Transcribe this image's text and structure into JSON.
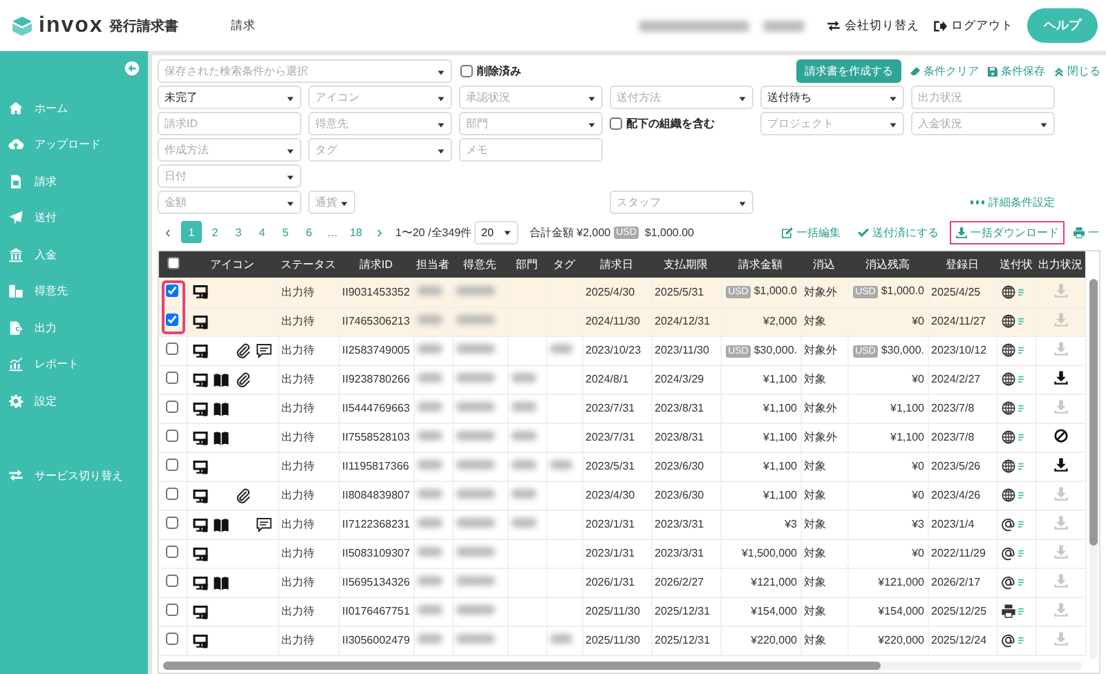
{
  "header": {
    "logo": "invox",
    "product": "発行請求書",
    "nav": "請求",
    "redacted": [
      {
        "kind": "company"
      },
      {
        "kind": "user"
      }
    ],
    "actions": [
      {
        "kind": "switch",
        "label": "会社切り替え"
      },
      {
        "kind": "logout",
        "label": "ログアウト"
      }
    ],
    "help": "ヘルプ"
  },
  "sidebar": {
    "items": [
      {
        "kind": "home",
        "label": "ホーム"
      },
      {
        "kind": "upload",
        "label": "アップロード"
      },
      {
        "kind": "document",
        "label": "請求"
      },
      {
        "kind": "send",
        "label": "送付"
      },
      {
        "kind": "bank",
        "label": "入金"
      },
      {
        "kind": "building",
        "label": "得意先"
      },
      {
        "kind": "export",
        "label": "出力"
      },
      {
        "kind": "chart",
        "label": "レポート"
      },
      {
        "kind": "gear",
        "label": "設定"
      }
    ],
    "footer": {
      "kind": "switch",
      "label": "サービス切り替え"
    }
  },
  "filters": {
    "saved": {
      "placeholder": "保存された検索条件から選択"
    },
    "deleted": {
      "label": "削除済み",
      "checked": false
    },
    "actions": [
      {
        "kind": "primary",
        "label": "請求書を作成する"
      },
      {
        "kind": "eraser",
        "label": "条件クリア"
      },
      {
        "kind": "save",
        "label": "条件保存"
      },
      {
        "kind": "collapse",
        "label": "閉じる"
      }
    ],
    "rows": [
      [
        {
          "kind": "select",
          "value": "未完了"
        },
        {
          "kind": "select",
          "placeholder": "アイコン"
        },
        {
          "kind": "select",
          "placeholder": "承認状況"
        },
        {
          "kind": "select",
          "placeholder": "送付方法"
        },
        {
          "kind": "select",
          "value": "送付待ち"
        },
        {
          "kind": "input",
          "placeholder": "出力状況"
        }
      ],
      [
        {
          "kind": "input",
          "placeholder": "請求ID"
        },
        {
          "kind": "select",
          "placeholder": "得意先"
        },
        {
          "kind": "select",
          "placeholder": "部門"
        },
        {
          "kind": "checkbox",
          "label": "配下の組織を含む",
          "checked": false
        },
        {
          "kind": "select",
          "placeholder": "プロジェクト"
        },
        {
          "kind": "select",
          "placeholder": "入金状況"
        }
      ],
      [
        {
          "kind": "select",
          "placeholder": "作成方法"
        },
        {
          "kind": "select",
          "placeholder": "タグ"
        },
        {
          "kind": "input",
          "placeholder": "メモ"
        }
      ],
      [
        {
          "kind": "select",
          "placeholder": "日付"
        }
      ],
      [
        {
          "kind": "select",
          "placeholder": "金額"
        },
        {
          "kind": "small-select",
          "placeholder": "通貨"
        },
        "",
        {
          "kind": "select",
          "placeholder": "スタッフ"
        }
      ]
    ],
    "advanced": "詳細条件設定"
  },
  "pagination": {
    "prev": "‹",
    "next": "›",
    "pages": [
      {
        "label": "1",
        "selected": true
      },
      {
        "label": "2",
        "selected": false
      },
      {
        "label": "3",
        "selected": false
      },
      {
        "label": "4",
        "selected": false
      },
      {
        "label": "5",
        "selected": false
      },
      {
        "label": "6",
        "selected": false
      },
      {
        "label": "…",
        "selected": false
      },
      {
        "label": "18",
        "selected": false
      }
    ],
    "range": "1〜20 /全349件",
    "per_page": "20",
    "total_label": "合計金額",
    "total_jpy": "¥2,000",
    "total_badge": "USD",
    "total_usd": "$1,000.00"
  },
  "toolbar": [
    {
      "kind": "edit",
      "label": "一括編集",
      "callout": false
    },
    {
      "kind": "sent",
      "label": "送付済にする",
      "callout": false
    },
    {
      "kind": "download",
      "label": "一括ダウンロード",
      "callout": true
    },
    {
      "kind": "print",
      "label": "一",
      "callout": false
    }
  ],
  "table": {
    "header_checked": false,
    "checkbox_callout": true,
    "columns": [
      "アイコン",
      "ステータス",
      "請求ID",
      "担当者",
      "得意先",
      "部門",
      "タグ",
      "請求日",
      "支払期限",
      "請求金額",
      "消込",
      "消込残高",
      "登録日",
      "送付状",
      "出力状況"
    ],
    "rows": [
      {
        "checked": true,
        "icons": [
          {
            "kind": "monitor"
          }
        ],
        "status": "出力待",
        "id": "II9031453352",
        "hidden_cells": [
          {
            "kind": "assignee"
          },
          {
            "kind": "customer"
          }
        ],
        "invoice_date": "2025/4/30",
        "due": "2025/5/31",
        "amount": {
          "badge": "USD",
          "text": "$1,000.0"
        },
        "reconcile": "対象外",
        "balance": {
          "badge": "USD",
          "text": "$1,000.0"
        },
        "registered": "2025/4/25",
        "send": {
          "kind": "web"
        },
        "output": {
          "kind": "pending"
        }
      },
      {
        "checked": true,
        "icons": [
          {
            "kind": "monitor"
          }
        ],
        "status": "出力待",
        "id": "II7465306213",
        "hidden_cells": [
          {
            "kind": "assignee"
          },
          {
            "kind": "customer"
          }
        ],
        "invoice_date": "2024/11/30",
        "due": "2024/12/31",
        "amount": {
          "text": "¥2,000"
        },
        "reconcile": "対象",
        "balance": {
          "text": "¥0"
        },
        "registered": "2024/11/27",
        "send": {
          "kind": "web"
        },
        "output": {
          "kind": "pending"
        }
      },
      {
        "checked": false,
        "icons": [
          {
            "kind": "monitor"
          },
          {
            "kind": "clip"
          },
          {
            "kind": "comment"
          }
        ],
        "status": "出力待",
        "id": "II2583749005",
        "hidden_cells": [
          {
            "kind": "assignee"
          },
          {
            "kind": "customer"
          },
          {
            "kind": "tag"
          }
        ],
        "invoice_date": "2023/10/23",
        "due": "2023/11/30",
        "amount": {
          "badge": "USD",
          "text": "$30,000."
        },
        "reconcile": "対象外",
        "balance": {
          "badge": "USD",
          "text": "$30,000."
        },
        "registered": "2023/10/12",
        "send": {
          "kind": "web"
        },
        "output": {
          "kind": "pending"
        }
      },
      {
        "checked": false,
        "icons": [
          {
            "kind": "monitor"
          },
          {
            "kind": "book"
          },
          {
            "kind": "clip"
          }
        ],
        "status": "出力待",
        "id": "II9238780266",
        "hidden_cells": [
          {
            "kind": "assignee"
          },
          {
            "kind": "customer"
          },
          {
            "kind": "department"
          }
        ],
        "invoice_date": "2024/8/1",
        "due": "2024/3/29",
        "amount": {
          "text": "¥1,100"
        },
        "reconcile": "対象",
        "balance": {
          "text": "¥0"
        },
        "registered": "2024/2/27",
        "send": {
          "kind": "web"
        },
        "output": {
          "kind": "ready"
        }
      },
      {
        "checked": false,
        "icons": [
          {
            "kind": "monitor"
          },
          {
            "kind": "book"
          }
        ],
        "status": "出力待",
        "id": "II5444769663",
        "hidden_cells": [
          {
            "kind": "assignee"
          },
          {
            "kind": "customer"
          },
          {
            "kind": "department"
          }
        ],
        "invoice_date": "2023/7/31",
        "due": "2023/8/31",
        "amount": {
          "text": "¥1,100"
        },
        "reconcile": "対象外",
        "balance": {
          "text": "¥1,100"
        },
        "registered": "2023/7/8",
        "send": {
          "kind": "web"
        },
        "output": {
          "kind": "pending"
        }
      },
      {
        "checked": false,
        "icons": [
          {
            "kind": "monitor"
          },
          {
            "kind": "book"
          }
        ],
        "status": "出力待",
        "id": "II7558528103",
        "hidden_cells": [
          {
            "kind": "assignee"
          },
          {
            "kind": "customer"
          },
          {
            "kind": "department"
          }
        ],
        "invoice_date": "2023/7/31",
        "due": "2023/8/31",
        "amount": {
          "text": "¥1,100"
        },
        "reconcile": "対象外",
        "balance": {
          "text": "¥1,100"
        },
        "registered": "2023/7/8",
        "send": {
          "kind": "web"
        },
        "output": {
          "kind": "blocked"
        }
      },
      {
        "checked": false,
        "icons": [
          {
            "kind": "monitor"
          }
        ],
        "status": "出力待",
        "id": "II1195817366",
        "hidden_cells": [
          {
            "kind": "assignee"
          },
          {
            "kind": "customer"
          },
          {
            "kind": "department"
          },
          {
            "kind": "tag"
          }
        ],
        "invoice_date": "2023/5/31",
        "due": "2023/6/30",
        "amount": {
          "text": "¥1,100"
        },
        "reconcile": "対象",
        "balance": {
          "text": "¥0"
        },
        "registered": "2023/5/26",
        "send": {
          "kind": "web"
        },
        "output": {
          "kind": "ready"
        }
      },
      {
        "checked": false,
        "icons": [
          {
            "kind": "monitor"
          },
          {
            "kind": "clip"
          }
        ],
        "status": "出力待",
        "id": "II8084839807",
        "hidden_cells": [
          {
            "kind": "assignee"
          },
          {
            "kind": "customer"
          },
          {
            "kind": "department"
          }
        ],
        "invoice_date": "2023/4/30",
        "due": "2023/6/30",
        "amount": {
          "text": "¥1,100"
        },
        "reconcile": "対象",
        "balance": {
          "text": "¥0"
        },
        "registered": "2023/4/26",
        "send": {
          "kind": "web"
        },
        "output": {
          "kind": "pending"
        }
      },
      {
        "checked": false,
        "icons": [
          {
            "kind": "monitor"
          },
          {
            "kind": "book"
          },
          {
            "kind": "comment"
          }
        ],
        "status": "出力待",
        "id": "II7122368231",
        "hidden_cells": [
          {
            "kind": "assignee"
          },
          {
            "kind": "customer"
          },
          {
            "kind": "department"
          }
        ],
        "invoice_date": "2023/1/31",
        "due": "2023/3/31",
        "amount": {
          "text": "¥3"
        },
        "reconcile": "対象",
        "balance": {
          "text": "¥3"
        },
        "registered": "2023/1/4",
        "send": {
          "kind": "email"
        },
        "output": {
          "kind": "pending"
        }
      },
      {
        "checked": false,
        "icons": [
          {
            "kind": "monitor"
          }
        ],
        "status": "出力待",
        "id": "II5083109307",
        "hidden_cells": [
          {
            "kind": "assignee"
          },
          {
            "kind": "customer"
          }
        ],
        "invoice_date": "2023/1/31",
        "due": "2023/3/31",
        "amount": {
          "text": "¥1,500,000"
        },
        "reconcile": "対象",
        "balance": {
          "text": "¥0"
        },
        "registered": "2022/11/29",
        "send": {
          "kind": "email"
        },
        "output": {
          "kind": "pending"
        }
      },
      {
        "checked": false,
        "icons": [
          {
            "kind": "monitor"
          },
          {
            "kind": "book"
          }
        ],
        "status": "出力待",
        "id": "II5695134326",
        "hidden_cells": [
          {
            "kind": "assignee"
          },
          {
            "kind": "customer"
          }
        ],
        "invoice_date": "2026/1/31",
        "due": "2026/2/27",
        "amount": {
          "text": "¥121,000"
        },
        "reconcile": "対象",
        "balance": {
          "text": "¥121,000"
        },
        "registered": "2026/2/17",
        "send": {
          "kind": "email"
        },
        "output": {
          "kind": "pending"
        }
      },
      {
        "checked": false,
        "icons": [
          {
            "kind": "monitor"
          }
        ],
        "status": "出力待",
        "id": "II0176467751",
        "hidden_cells": [
          {
            "kind": "assignee"
          },
          {
            "kind": "customer"
          }
        ],
        "invoice_date": "2025/11/30",
        "due": "2025/12/31",
        "amount": {
          "text": "¥154,000"
        },
        "reconcile": "対象",
        "balance": {
          "text": "¥154,000"
        },
        "registered": "2025/12/25",
        "send": {
          "kind": "print"
        },
        "output": {
          "kind": "pending"
        }
      },
      {
        "checked": false,
        "icons": [
          {
            "kind": "monitor"
          }
        ],
        "status": "出力待",
        "id": "II3056002479",
        "hidden_cells": [
          {
            "kind": "assignee"
          },
          {
            "kind": "customer"
          },
          {
            "kind": "tag"
          }
        ],
        "invoice_date": "2025/11/30",
        "due": "2025/12/31",
        "amount": {
          "text": "¥220,000"
        },
        "reconcile": "対象",
        "balance": {
          "text": "¥220,000"
        },
        "registered": "2025/12/24",
        "send": {
          "kind": "email"
        },
        "output": {
          "kind": "pending"
        }
      }
    ]
  }
}
